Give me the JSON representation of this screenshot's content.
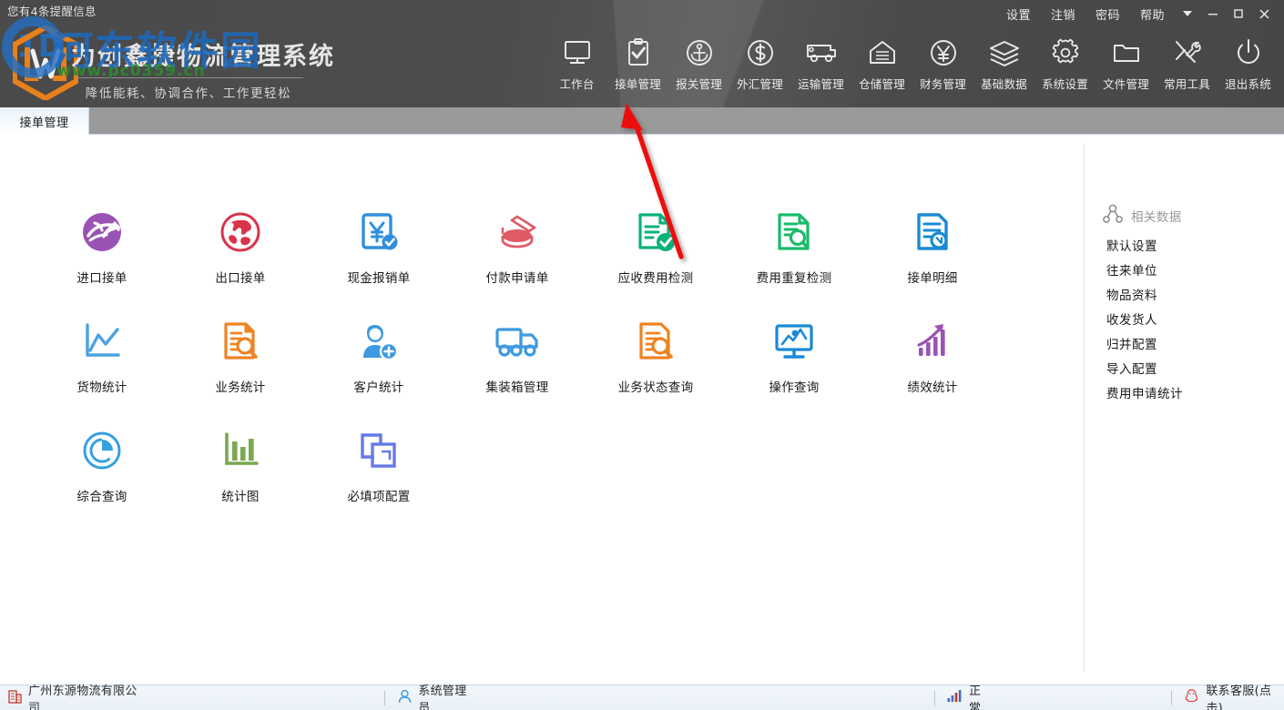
{
  "header": {
    "reminder": "您有4条提醒信息",
    "watermark_text": "河东软件园",
    "watermark_url": "www.pc0359.cn",
    "watermark_ring_text": "1D",
    "brand_title": "为创鑫捷物流管理系统",
    "brand_sub": "降低能耗、协调合作、工作更轻松",
    "logo_letter": "W"
  },
  "topmenu": {
    "items": [
      {
        "label": "设置",
        "name": "settings"
      },
      {
        "label": "注销",
        "name": "logout"
      },
      {
        "label": "密码",
        "name": "password"
      },
      {
        "label": "帮助",
        "name": "help"
      }
    ],
    "window_buttons": [
      {
        "name": "chevron-down-icon",
        "label": "▼"
      },
      {
        "name": "minimize-button",
        "label": "—"
      },
      {
        "name": "maximize-button",
        "label": "▫"
      },
      {
        "name": "close-button",
        "label": "✕"
      }
    ]
  },
  "nav": {
    "items": [
      {
        "label": "工作台",
        "icon": "monitor-icon"
      },
      {
        "label": "接单管理",
        "icon": "clipboard-check-icon"
      },
      {
        "label": "报关管理",
        "icon": "anchor-icon"
      },
      {
        "label": "外汇管理",
        "icon": "dollar-circle-icon"
      },
      {
        "label": "运输管理",
        "icon": "truck-icon"
      },
      {
        "label": "仓储管理",
        "icon": "warehouse-icon"
      },
      {
        "label": "财务管理",
        "icon": "yen-circle-icon"
      },
      {
        "label": "基础数据",
        "icon": "layers-icon"
      },
      {
        "label": "系统设置",
        "icon": "gear-icon"
      },
      {
        "label": "文件管理",
        "icon": "folder-icon"
      },
      {
        "label": "常用工具",
        "icon": "tools-icon"
      },
      {
        "label": "退出系统",
        "icon": "power-icon"
      }
    ]
  },
  "tabs": [
    {
      "label": "接单管理",
      "active": true
    }
  ],
  "main": {
    "tiles": [
      {
        "label": "进口接单",
        "icon": "globe-plane-icon",
        "color": "#9a52b5"
      },
      {
        "label": "出口接单",
        "icon": "globe-icon",
        "color": "#d9344a"
      },
      {
        "label": "现金报销单",
        "icon": "yen-doc-check-icon",
        "color": "#2f8fdc"
      },
      {
        "label": "付款申请单",
        "icon": "payment-coins-icon",
        "color": "#e05a66"
      },
      {
        "label": "应收费用检测",
        "icon": "doc-check-icon",
        "color": "#09b27a"
      },
      {
        "label": "费用重复检测",
        "icon": "doc-search-icon",
        "color": "#18bb6b"
      },
      {
        "label": "接单明细",
        "icon": "doc-detail-icon",
        "color": "#1a8ad4"
      },
      {
        "label": "货物统计",
        "icon": "line-chart-icon",
        "color": "#4ba3dd"
      },
      {
        "label": "业务统计",
        "icon": "doc-search-orange-icon",
        "color": "#ef8321"
      },
      {
        "label": "客户统计",
        "icon": "user-add-icon",
        "color": "#3d9ae0"
      },
      {
        "label": "集装箱管理",
        "icon": "container-truck-icon",
        "color": "#3d9ae0"
      },
      {
        "label": "业务状态查询",
        "icon": "doc-search-icon-orange",
        "color": "#ef8321"
      },
      {
        "label": "操作查询",
        "icon": "monitor-chart-icon",
        "color": "#1a8ad4"
      },
      {
        "label": "绩效统计",
        "icon": "growth-chart-icon",
        "color": "#9a52b5"
      },
      {
        "label": "综合查询",
        "icon": "pie-chart-icon",
        "color": "#36a0e0"
      },
      {
        "label": "统计图",
        "icon": "bar-chart-icon",
        "color": "#7aa84f"
      },
      {
        "label": "必填项配置",
        "icon": "copy-squares-icon",
        "color": "#6679e8"
      }
    ]
  },
  "right_panel": {
    "header": "相关数据",
    "header_icon": "person-network-icon",
    "items": [
      {
        "label": "默认设置"
      },
      {
        "label": "往来单位"
      },
      {
        "label": "物品资料"
      },
      {
        "label": "收发货人"
      },
      {
        "label": "归并配置"
      },
      {
        "label": "导入配置"
      },
      {
        "label": "费用申请统计"
      }
    ]
  },
  "statusbar": {
    "company": "广州东源物流有限公司",
    "company_icon": "building-icon",
    "user": "系统管理员",
    "user_icon": "person-icon",
    "connection": "正常",
    "connection_icon": "signal-bars-icon",
    "support": "联系客服(点击)",
    "support_icon": "qq-icon"
  },
  "annotation": {
    "arrow_color": "#ee1111"
  }
}
